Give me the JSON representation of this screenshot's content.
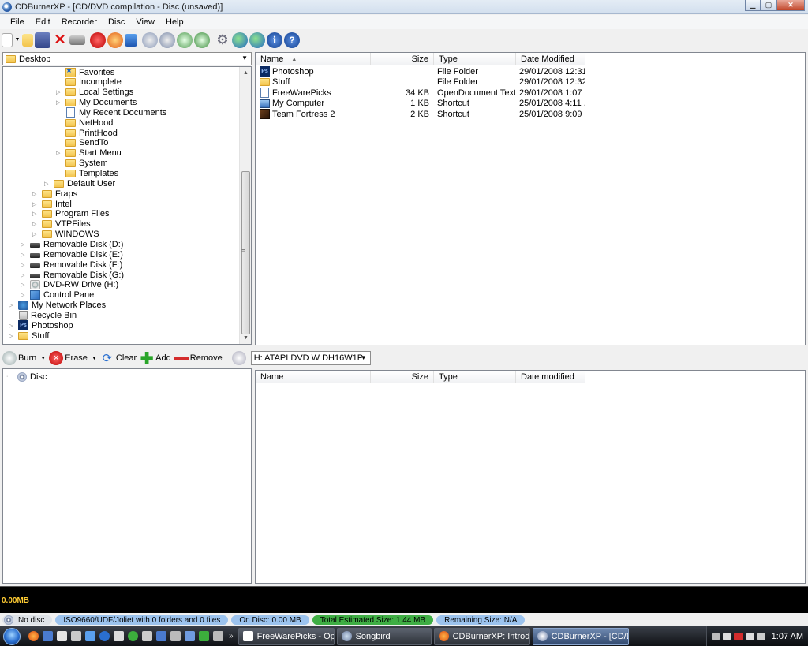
{
  "window": {
    "title": "CDBurnerXP - [CD/DVD compilation - Disc (unsaved)]"
  },
  "menu": [
    "File",
    "Edit",
    "Recorder",
    "Disc",
    "View",
    "Help"
  ],
  "source": {
    "location": "Desktop",
    "tree": [
      {
        "label": "Favorites",
        "icon": "favorites",
        "expander": false
      },
      {
        "label": "Incomplete",
        "icon": "folder",
        "expander": false
      },
      {
        "label": "Local Settings",
        "icon": "folder",
        "expander": true
      },
      {
        "label": "My Documents",
        "icon": "folder",
        "expander": true
      },
      {
        "label": "My Recent Documents",
        "icon": "recent",
        "expander": false
      },
      {
        "label": "NetHood",
        "icon": "folder",
        "expander": false
      },
      {
        "label": "PrintHood",
        "icon": "folder",
        "expander": false
      },
      {
        "label": "SendTo",
        "icon": "folder",
        "expander": false
      },
      {
        "label": "Start Menu",
        "icon": "folder",
        "expander": true
      },
      {
        "label": "System",
        "icon": "folder",
        "expander": false
      },
      {
        "label": "Templates",
        "icon": "folder",
        "expander": false
      },
      {
        "label": "Default User",
        "icon": "folder",
        "expander": true
      },
      {
        "label": "Fraps",
        "icon": "folder",
        "expander": true
      },
      {
        "label": "Intel",
        "icon": "folder",
        "expander": true
      },
      {
        "label": "Program Files",
        "icon": "folder",
        "expander": true
      },
      {
        "label": "VTPFiles",
        "icon": "folder",
        "expander": true
      },
      {
        "label": "WINDOWS",
        "icon": "folder",
        "expander": true
      },
      {
        "label": "Removable Disk (D:)",
        "icon": "drive",
        "expander": true
      },
      {
        "label": "Removable Disk (E:)",
        "icon": "drive",
        "expander": true
      },
      {
        "label": "Removable Disk (F:)",
        "icon": "drive",
        "expander": true
      },
      {
        "label": "Removable Disk (G:)",
        "icon": "drive",
        "expander": true
      },
      {
        "label": "DVD-RW Drive (H:)",
        "icon": "dvd",
        "expander": true
      },
      {
        "label": "Control Panel",
        "icon": "control",
        "expander": true
      },
      {
        "label": "My Network Places",
        "icon": "network",
        "expander": true
      },
      {
        "label": "Recycle Bin",
        "icon": "bin",
        "expander": false
      },
      {
        "label": "Photoshop",
        "icon": "ps",
        "expander": true
      },
      {
        "label": "Stuff",
        "icon": "folder",
        "expander": true
      }
    ],
    "columns": {
      "name": "Name",
      "size": "Size",
      "type": "Type",
      "date": "Date Modified"
    },
    "files": [
      {
        "name": "Photoshop",
        "size": "",
        "type": "File Folder",
        "date": "29/01/2008 12:31...",
        "icon": "ps"
      },
      {
        "name": "Stuff",
        "size": "",
        "type": "File Folder",
        "date": "29/01/2008 12:32...",
        "icon": "folder"
      },
      {
        "name": "FreeWarePicks",
        "size": "34 KB",
        "type": "OpenDocument Text",
        "date": "29/01/2008 1:07 ...",
        "icon": "doc"
      },
      {
        "name": "My Computer",
        "size": "1 KB",
        "type": "Shortcut",
        "date": "25/01/2008 4:11 ...",
        "icon": "pc"
      },
      {
        "name": "Team Fortress 2",
        "size": "2 KB",
        "type": "Shortcut",
        "date": "25/01/2008 9:09 ...",
        "icon": "tf"
      }
    ]
  },
  "compilation_toolbar": {
    "burn": "Burn",
    "erase": "Erase",
    "clear": "Clear",
    "add": "Add",
    "remove": "Remove",
    "drive": "H: ATAPI DVD W  DH16W1P"
  },
  "compilation": {
    "root": "Disc",
    "columns": {
      "name": "Name",
      "size": "Size",
      "type": "Type",
      "date": "Date modified"
    }
  },
  "progress": {
    "size": "0.00MB"
  },
  "status": {
    "disc": "No disc",
    "filesystem": "ISO9660/UDF/Joliet with 0 folders and 0 files",
    "on_disc": "On Disc: 0.00 MB",
    "total": "Total Estimated Size: 1.44 MB",
    "remaining": "Remaining Size: N/A"
  },
  "taskbar": {
    "tasks": [
      "FreeWarePicks - Ope...",
      "Songbird",
      "CDBurnerXP: Introdu...",
      "CDBurnerXP - [CD/D..."
    ],
    "clock": "1:07 AM"
  },
  "colors": {
    "status_blue": "#9cc3ee",
    "status_green": "#3fae44",
    "progress_text": "#ffcc33"
  }
}
